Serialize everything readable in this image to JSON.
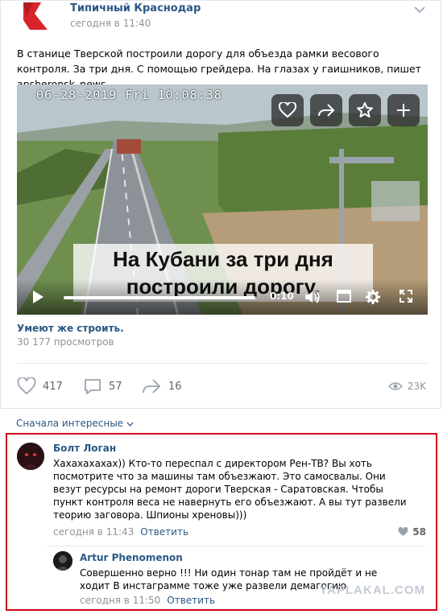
{
  "post": {
    "group_name": "Типичный Краснодар",
    "time": "сегодня в 11:40",
    "text": "В станице Тверской построили дорогу для объезда рамки весового контроля. За три дня. С помощью грейдера. На глазах у гаишников, пишет apsheronsk_news",
    "brand_color": "#d8242b"
  },
  "video": {
    "timestamp": "06-28-2019 Fri 10:08:38",
    "caption": "На Кубани за три дня построили дорогу,",
    "duration": "0:10",
    "progress_percent": 99,
    "title": "Умеют же строить.",
    "views": "30 177 просмотров",
    "overlay_icons": [
      "heart-icon",
      "share-icon",
      "star-icon",
      "plus-icon"
    ],
    "control_icons": [
      "play-icon",
      "volume-icon",
      "miniplayer-icon",
      "settings-icon",
      "fullscreen-icon"
    ]
  },
  "actions": {
    "likes": "417",
    "comments": "57",
    "shares": "16",
    "views": "23K"
  },
  "comments_sort": "Сначала интересные",
  "comments": [
    {
      "author": "Болт Логан",
      "text": "Хахахахахах)) Кто-то переспал с директором Рен-ТВ? Вы хоть посмотрите что за машины там объезжают. Это самосвалы. Они везут ресурсы на ремонт дороги Тверская - Саратовская. Чтобы пункт контроля веса не навернуть его объезжают. А вы тут развели теорию заговора. Шпионы хреновы)))",
      "time": "сегодня в 11:43",
      "reply_label": "Ответить",
      "likes": "58"
    },
    {
      "author": "Artur Phenomenon",
      "text": "Совершенно верно !!! Ни один тонар там не пройдёт и не ходит В инстаграмме тоже уже развели демагогию",
      "time": "сегодня в 11:50",
      "reply_label": "Ответить"
    }
  ],
  "watermark": "YAPLAKAL.COM",
  "highlight_color": "#d0021b"
}
